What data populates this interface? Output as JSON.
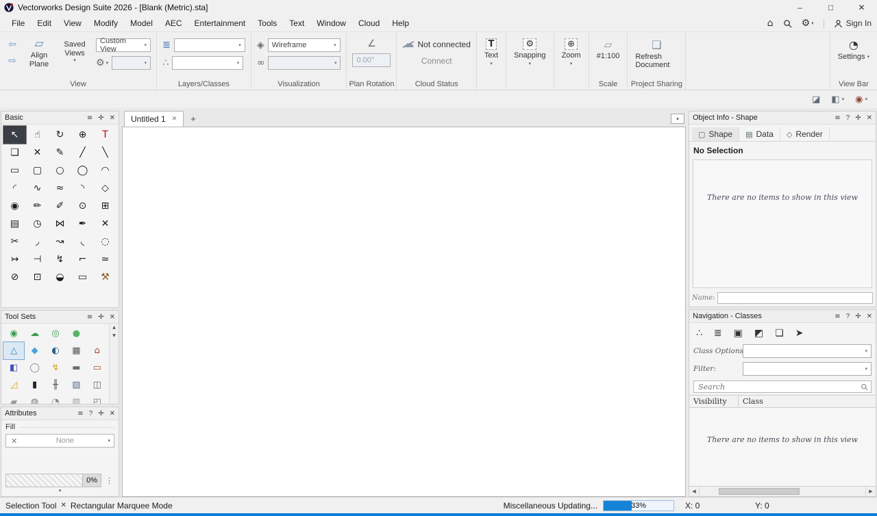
{
  "ui": {
    "menu_icon": "≡",
    "help_icon": "?",
    "pin_icon": "✛",
    "close_icon": "✕",
    "chevron": "▾",
    "dots": "⋮",
    "up": "▲",
    "down": "▼",
    "left": "◀",
    "right": "▶"
  },
  "colors": {
    "accent": "#0b7bd8",
    "selection_dark": "#3a3f46"
  },
  "window": {
    "title": "Vectorworks Design Suite 2026 - [Blank (Metric).sta]",
    "minimize": "–",
    "maximize": "□",
    "close": "✕"
  },
  "menubar": {
    "items": [
      {
        "name": "menu-file",
        "label": "File"
      },
      {
        "name": "menu-edit",
        "label": "Edit"
      },
      {
        "name": "menu-view",
        "label": "View"
      },
      {
        "name": "menu-modify",
        "label": "Modify"
      },
      {
        "name": "menu-model",
        "label": "Model"
      },
      {
        "name": "menu-aec",
        "label": "AEC"
      },
      {
        "name": "menu-entertainment",
        "label": "Entertainment"
      },
      {
        "name": "menu-tools",
        "label": "Tools"
      },
      {
        "name": "menu-text",
        "label": "Text"
      },
      {
        "name": "menu-window",
        "label": "Window"
      },
      {
        "name": "menu-cloud",
        "label": "Cloud"
      },
      {
        "name": "menu-help",
        "label": "Help"
      }
    ],
    "home_icon": "⌂",
    "gear_icon": "⚙",
    "sign_in": "Sign In"
  },
  "toolbar": {
    "back_icon": "⇦",
    "forward_icon": "⇨",
    "align_plane_icon": "▱",
    "align_plane_label": "Align Plane",
    "saved_views_label": "Saved Views",
    "view_options_icon": "⚙",
    "custom_view_value": "Custom View",
    "layers_icon": "≣",
    "classes_icon": "∴",
    "render_cube_icon": "◈",
    "glasses_icon": "∞",
    "render_mode_value": "Wireframe",
    "rotation_icon": "∠",
    "rotation_value": "0.00°",
    "cloud_icon": "☁",
    "cloud_status": "Not connected",
    "connect_label": "Connect",
    "text_icon": "T",
    "text_label": "Text",
    "snapping_icon": "⚙",
    "snapping_label": "Snapping",
    "zoom_icon": "⊕",
    "zoom_label": "Zoom",
    "scale_icon": "▱",
    "scale_value": "#1:100",
    "project_icon": "❏",
    "refresh_label": "Refresh Document",
    "settings_icon": "◔",
    "settings_label": "Settings",
    "sections": {
      "view": "View",
      "layers": "Layers/Classes",
      "visualization": "Visualization",
      "plan_rotation": "Plan Rotation",
      "cloud": "Cloud Status",
      "scale": "Scale",
      "project": "Project Sharing",
      "viewbar": "View Bar"
    }
  },
  "quickbar": {
    "icon1": "◪",
    "icon2": "◧",
    "icon3": "◉"
  },
  "basic_palette": {
    "title": "Basic",
    "tools": [
      {
        "name": "selection-tool-icon",
        "glyph": "↖",
        "selected": true
      },
      {
        "name": "pan-tool-icon",
        "glyph": "☝"
      },
      {
        "name": "flyover-tool-icon",
        "glyph": "↻"
      },
      {
        "name": "zoom-tool-icon",
        "glyph": "⊕"
      },
      {
        "name": "text-tool-icon",
        "glyph": "T",
        "color": "#c00000"
      },
      {
        "name": "callout-tool-icon",
        "glyph": "❑"
      },
      {
        "name": "delete-tool-icon",
        "glyph": "✕"
      },
      {
        "name": "eyedropper-tool-icon",
        "glyph": "✎"
      },
      {
        "name": "line-tool-icon",
        "glyph": "╱"
      },
      {
        "name": "double-line-tool-icon",
        "glyph": "╲"
      },
      {
        "name": "rectangle-tool-icon",
        "glyph": "▭"
      },
      {
        "name": "rounded-rectangle-tool-icon",
        "glyph": "▢"
      },
      {
        "name": "circle-tool-icon",
        "glyph": "○"
      },
      {
        "name": "oval-tool-icon",
        "glyph": "◯"
      },
      {
        "name": "arc-tool-icon",
        "glyph": "◠"
      },
      {
        "name": "polyline-tool-icon",
        "glyph": "◜"
      },
      {
        "name": "freehand-tool-icon",
        "glyph": "∿"
      },
      {
        "name": "curve-tool-icon",
        "glyph": "≈"
      },
      {
        "name": "surface-tool-icon",
        "glyph": "◝"
      },
      {
        "name": "polygon-tool-icon",
        "glyph": "◇"
      },
      {
        "name": "spiral-tool-icon",
        "glyph": "◉"
      },
      {
        "name": "pen-tool-icon",
        "glyph": "✏"
      },
      {
        "name": "attribute-pen-tool-icon",
        "glyph": "✐"
      },
      {
        "name": "visibility-tool-icon",
        "glyph": "⊙"
      },
      {
        "name": "stamp-tool-icon",
        "glyph": "⊞"
      },
      {
        "name": "extrude-tool-icon",
        "glyph": "▤"
      },
      {
        "name": "rotate-tool-icon",
        "glyph": "◷"
      },
      {
        "name": "mirror-tool-icon",
        "glyph": "⋈"
      },
      {
        "name": "shear-tool-icon",
        "glyph": "✒"
      },
      {
        "name": "clip-tool-icon",
        "glyph": "✕"
      },
      {
        "name": "split-tool-icon",
        "glyph": "✂"
      },
      {
        "name": "fillet-tool-icon",
        "glyph": "◞"
      },
      {
        "name": "offset-tool-icon",
        "glyph": "↝"
      },
      {
        "name": "chamfer-tool-icon",
        "glyph": "◟"
      },
      {
        "name": "freeform-tool-icon",
        "glyph": "◌"
      },
      {
        "name": "connect-combine-tool-icon",
        "glyph": "↣"
      },
      {
        "name": "dimension-tool-icon",
        "glyph": "⊣"
      },
      {
        "name": "zigzag-tool-icon",
        "glyph": "↯"
      },
      {
        "name": "corner-tool-icon",
        "glyph": "⌐"
      },
      {
        "name": "similar-tool-icon",
        "glyph": "≃"
      },
      {
        "name": "clip-cube-tool-icon",
        "glyph": "⊘"
      },
      {
        "name": "focus-tool-icon",
        "glyph": "⊡"
      },
      {
        "name": "protractor-tool-icon",
        "glyph": "◒"
      },
      {
        "name": "marquee-tool-icon",
        "glyph": "▭"
      },
      {
        "name": "attribute-hammer-tool-icon",
        "glyph": "⚒",
        "color": "#8b5a2b"
      }
    ]
  },
  "tool_sets": {
    "title": "Tool Sets",
    "tools": [
      {
        "name": "planting-tool-icon",
        "glyph": "◉",
        "color": "#3a9d4e"
      },
      {
        "name": "landscape-area-tool-icon",
        "glyph": "☁",
        "color": "#3a9d4e"
      },
      {
        "name": "site-model-tool-icon",
        "glyph": "◎",
        "color": "#3a9d4e"
      },
      {
        "name": "shrub-tool-icon",
        "glyph": "●",
        "color": "#58b368"
      },
      {
        "name": "toolset-spacer",
        "glyph": ""
      },
      {
        "name": "terrain-modifier-tool-icon",
        "glyph": "△",
        "color": "#3f7fbf",
        "selected": true
      },
      {
        "name": "irrigation-tool-icon",
        "glyph": "◆",
        "color": "#4aa3df"
      },
      {
        "name": "geo-locate-tool-icon",
        "glyph": "◐",
        "color": "#2b5f8a"
      },
      {
        "name": "space-tool-icon",
        "glyph": "▦",
        "color": "#555555"
      },
      {
        "name": "building-tool-icon",
        "glyph": "⌂",
        "color": "#b03a2e"
      },
      {
        "name": "window-tool-icon",
        "glyph": "◧",
        "color": "#4053b5"
      },
      {
        "name": "massing-model-tool-icon",
        "glyph": "◯",
        "color": "#808080"
      },
      {
        "name": "electrical-tool-icon",
        "glyph": "↯",
        "color": "#d4a017"
      },
      {
        "name": "furniture-tool-icon",
        "glyph": "▬",
        "color": "#6e6e6e"
      },
      {
        "name": "framing-tool-icon",
        "glyph": "▭",
        "color": "#a0522d"
      },
      {
        "name": "roof-tool-icon",
        "glyph": "◿",
        "color": "#d9a520"
      },
      {
        "name": "column-tool-icon",
        "glyph": "▮",
        "color": "#222222"
      },
      {
        "name": "railing-tool-icon",
        "glyph": "╫",
        "color": "#555555"
      },
      {
        "name": "hardscape-tool-icon",
        "glyph": "▨",
        "color": "#5a6b8c"
      },
      {
        "name": "camera-tool-icon",
        "glyph": "◫",
        "color": "#666666"
      },
      {
        "name": "wall-tool-icon",
        "glyph": "▰",
        "color": "#999999"
      },
      {
        "name": "slab-tool-icon",
        "glyph": "◍",
        "color": "#777777"
      },
      {
        "name": "dome-tool-icon",
        "glyph": "◔",
        "color": "#888888"
      },
      {
        "name": "grid-tool-icon",
        "glyph": "▥",
        "color": "#999999"
      },
      {
        "name": "viewport-tool-icon",
        "glyph": "◰",
        "color": "#777777"
      }
    ]
  },
  "attributes": {
    "title": "Attributes",
    "fill_label": "Fill",
    "none_icon": "✕",
    "fill_value": "None",
    "opacity_value": "0%"
  },
  "document": {
    "tab_title": "Untitled 1",
    "close_icon": "✕",
    "new_tab_icon": "+"
  },
  "object_info": {
    "title": "Object Info - Shape",
    "tabs": [
      {
        "name": "object-info-tab-shape",
        "icon": "▢",
        "label": "Shape",
        "selected": true
      },
      {
        "name": "object-info-tab-data",
        "icon": "▤",
        "label": "Data"
      },
      {
        "name": "object-info-tab-render",
        "icon": "◇",
        "label": "Render"
      }
    ],
    "status": "No Selection",
    "empty_text": "There are no items to show in this view",
    "name_label": "Name:"
  },
  "navigation": {
    "title": "Navigation - Classes",
    "icons": [
      {
        "name": "classes-icon",
        "glyph": "∴"
      },
      {
        "name": "design-layers-icon",
        "glyph": "≣"
      },
      {
        "name": "viewports-icon",
        "glyph": "▣"
      },
      {
        "name": "saved-views-icon",
        "glyph": "◩"
      },
      {
        "name": "references-icon",
        "glyph": "❏"
      },
      {
        "name": "publish-icon",
        "glyph": "➤"
      }
    ],
    "class_options_label": "Class Options:",
    "filter_label": "Filter:",
    "search_placeholder": "Search",
    "col_visibility": "Visibility",
    "col_class": "Class",
    "empty_text": "There are no items to show in this view"
  },
  "statusbar": {
    "tool_name": "Selection Tool",
    "mode_icon": "✕",
    "mode_name": "Rectangular Marquee Mode",
    "progress_label": "Miscellaneous Updating...",
    "progress_text": "33%",
    "x_label": "X: 0",
    "y_label": "Y: 0"
  }
}
